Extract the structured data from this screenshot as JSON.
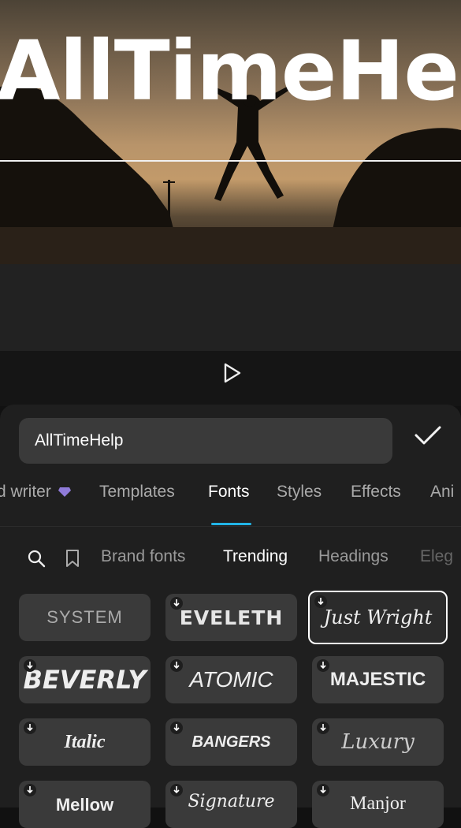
{
  "preview": {
    "overlay_text": "AllTimeHelp"
  },
  "editor": {
    "text_value": "AllTimeHelp"
  },
  "tabs": [
    {
      "label": "d writer"
    },
    {
      "label": "Templates"
    },
    {
      "label": "Fonts"
    },
    {
      "label": "Styles"
    },
    {
      "label": "Effects"
    },
    {
      "label": "Ani"
    }
  ],
  "categories": [
    {
      "label": "Brand fonts"
    },
    {
      "label": "Trending"
    },
    {
      "label": "Headings"
    },
    {
      "label": "Eleg"
    }
  ],
  "fonts": [
    {
      "name": "SYSTEM"
    },
    {
      "name": "EVELETH"
    },
    {
      "name": "Just Wright"
    },
    {
      "name": "BEVERLY"
    },
    {
      "name": "ATOMIC"
    },
    {
      "name": "MAJESTIC"
    },
    {
      "name": "Italic"
    },
    {
      "name": "BANGERS"
    },
    {
      "name": "Luxury"
    },
    {
      "name": "Mellow"
    },
    {
      "name": "Signature"
    },
    {
      "name": "Manjor"
    }
  ],
  "colors": {
    "accent": "#22b4e6",
    "premium": "#8f7bd9"
  }
}
